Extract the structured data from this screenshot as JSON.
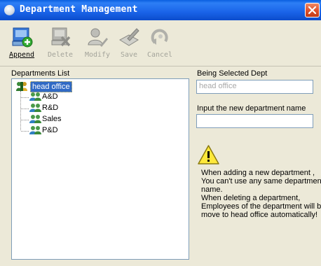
{
  "window": {
    "title": "Department Management",
    "icons": {
      "app": "clock-icon",
      "close": "close-icon"
    }
  },
  "toolbar": {
    "buttons": [
      {
        "key": "append",
        "label": "Append",
        "enabled": true,
        "icon": "add-record-icon"
      },
      {
        "key": "delete",
        "label": "Delete",
        "enabled": false,
        "icon": "delete-record-icon"
      },
      {
        "key": "modify",
        "label": "Modify",
        "enabled": false,
        "icon": "modify-user-icon"
      },
      {
        "key": "save",
        "label": "Save",
        "enabled": false,
        "icon": "save-pen-icon"
      },
      {
        "key": "cancel",
        "label": "Cancel",
        "enabled": false,
        "icon": "cancel-undo-icon"
      }
    ]
  },
  "departments": {
    "label": "Departments List",
    "root": {
      "label": "head office",
      "selected": true,
      "icon": "root-dept-icon"
    },
    "children": [
      {
        "label": "A&D",
        "icon": "group-users-icon"
      },
      {
        "label": "R&D",
        "icon": "group-users-icon"
      },
      {
        "label": "Sales",
        "icon": "group-users-icon"
      },
      {
        "label": "P&D",
        "icon": "group-users-icon"
      }
    ]
  },
  "selected_dept": {
    "label": "Being Selected Dept",
    "value": "head office"
  },
  "new_dept": {
    "label": "Input the new department name",
    "value": ""
  },
  "notes": {
    "icon": "warning-icon",
    "lines": [
      "When adding a new department ,",
      "You can't use any same department",
      "name.",
      "When deleting a department,",
      "Employees of the department will be",
      "move to head office automatically!"
    ]
  },
  "colors": {
    "titlebar": "#0a5fe0",
    "selection": "#316ac5",
    "window_bg": "#ece9d8",
    "close": "#e0532e"
  }
}
